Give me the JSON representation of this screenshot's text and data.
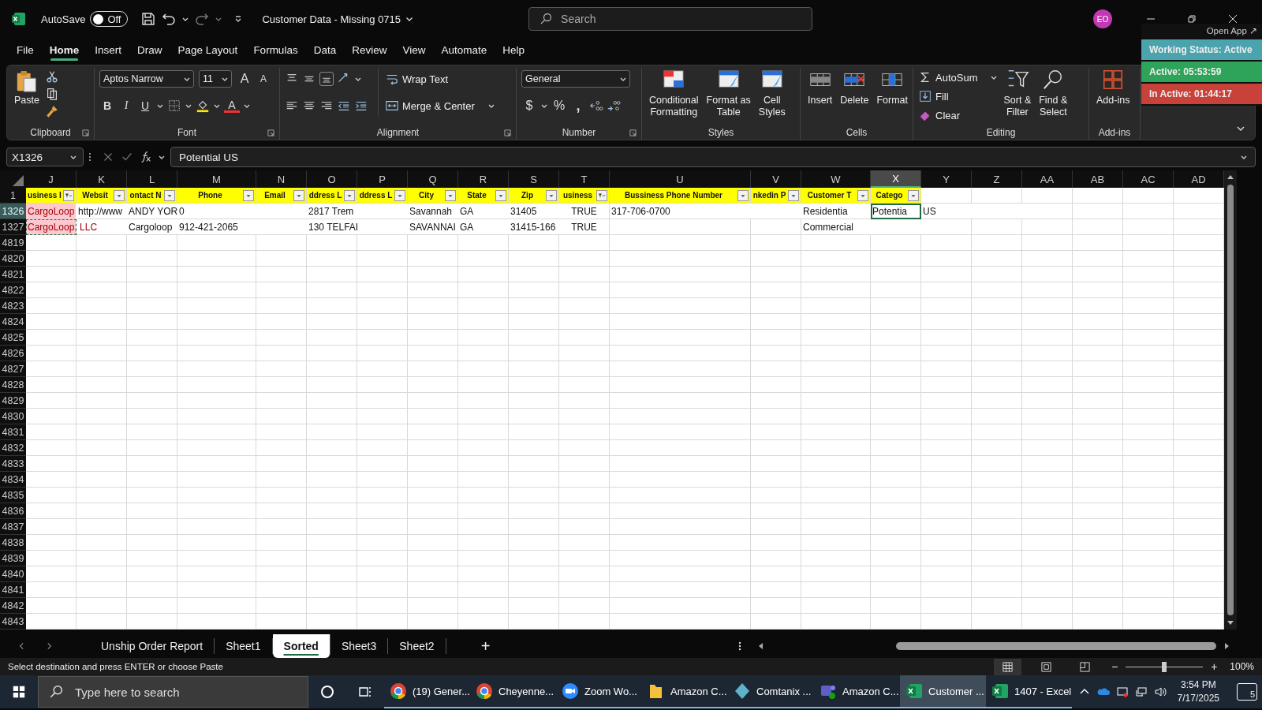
{
  "title_bar": {
    "autosave_label": "AutoSave",
    "autosave": {
      "on": false,
      "label": "Off"
    },
    "title": "Customer Data - Missing 0715",
    "search_placeholder": "Search",
    "avatar": "EO"
  },
  "menu": [
    {
      "label": "File",
      "selected": false
    },
    {
      "label": "Home",
      "selected": true
    },
    {
      "label": "Insert",
      "selected": false
    },
    {
      "label": "Draw",
      "selected": false
    },
    {
      "label": "Page Layout",
      "selected": false
    },
    {
      "label": "Formulas",
      "selected": false
    },
    {
      "label": "Data",
      "selected": false
    },
    {
      "label": "Review",
      "selected": false
    },
    {
      "label": "View",
      "selected": false
    },
    {
      "label": "Automate",
      "selected": false
    },
    {
      "label": "Help",
      "selected": false
    }
  ],
  "ribbon": {
    "clipboard": {
      "label": "Clipboard",
      "paste": "Paste"
    },
    "font": {
      "label": "Font",
      "name": "Aptos Narrow",
      "size": "11",
      "grow": "A",
      "shrink": "A",
      "bold": "B",
      "italic": "I",
      "underline": "U",
      "color_letter": "A"
    },
    "alignment": {
      "label": "Alignment",
      "wrap": "Wrap Text",
      "merge": "Merge & Center"
    },
    "number": {
      "label": "Number",
      "format": "General",
      "currency": "$",
      "percent": "%",
      "comma": ","
    },
    "styles": {
      "label": "Styles",
      "buttons": [
        "Conditional\nFormatting",
        "Format as\nTable",
        "Cell\nStyles"
      ]
    },
    "cells": {
      "label": "Cells",
      "buttons": [
        "Insert",
        "Delete",
        "Format"
      ]
    },
    "editing": {
      "label": "Editing",
      "autosum": "AutoSum",
      "fill": "Fill",
      "clear": "Clear",
      "sort": "Sort &\nFilter",
      "find": "Find &\nSelect"
    },
    "addins": {
      "label": "Add-ins",
      "button": "Add-ins"
    }
  },
  "status_widget": {
    "open_app": "Open App ↗",
    "status": "Working Status: Active",
    "active": "Active: 05:53:59",
    "inactive": "In Active: 01:44:17"
  },
  "formula_bar": {
    "name_box": "X1326",
    "formula": "Potential US"
  },
  "sheet": {
    "columns": [
      {
        "letter": "J",
        "selected": false
      },
      {
        "letter": "K",
        "selected": false
      },
      {
        "letter": "L",
        "selected": false
      },
      {
        "letter": "M",
        "selected": false
      },
      {
        "letter": "N",
        "selected": false
      },
      {
        "letter": "O",
        "selected": false
      },
      {
        "letter": "P",
        "selected": false
      },
      {
        "letter": "Q",
        "selected": false
      },
      {
        "letter": "R",
        "selected": false
      },
      {
        "letter": "S",
        "selected": false
      },
      {
        "letter": "T",
        "selected": false
      },
      {
        "letter": "U",
        "selected": false
      },
      {
        "letter": "V",
        "selected": false
      },
      {
        "letter": "W",
        "selected": false
      },
      {
        "letter": "X",
        "selected": true
      },
      {
        "letter": "Y",
        "selected": false
      },
      {
        "letter": "Z",
        "selected": false
      },
      {
        "letter": "AA",
        "selected": false
      },
      {
        "letter": "AB",
        "selected": false
      },
      {
        "letter": "AC",
        "selected": false
      },
      {
        "letter": "AD",
        "selected": false
      }
    ],
    "rows": [
      {
        "number": "1",
        "selected": false,
        "kind": "header",
        "cells": [
          {
            "text": "usiness I",
            "filtered": true
          },
          {
            "text": "Websit",
            "filtered": false
          },
          {
            "text": "ontact N",
            "filtered": false
          },
          {
            "text": "Phone",
            "filtered": false
          },
          {
            "text": "Email",
            "filtered": false
          },
          {
            "text": "ddress L",
            "filtered": false
          },
          {
            "text": "ddress L",
            "filtered": false
          },
          {
            "text": "City",
            "filtered": false
          },
          {
            "text": "State",
            "filtered": false
          },
          {
            "text": "Zip",
            "filtered": false
          },
          {
            "text": "usiness",
            "filtered": true
          },
          {
            "text": "Bussiness Phone Number",
            "filtered": false
          },
          {
            "text": "nkedin P",
            "filtered": false
          },
          {
            "text": "Customer T",
            "filtered": false
          },
          {
            "text": "Catego",
            "filtered": false
          }
        ]
      },
      {
        "number": "1326",
        "selected": true,
        "kind": "data",
        "cells": [
          {
            "text": "CargoLoop",
            "kind": "flagged",
            "copied": false
          },
          {
            "text": "http://www"
          },
          {
            "text": "ANDY YOR"
          },
          {
            "text": "0"
          },
          null,
          {
            "text": "2817 Trem"
          },
          null,
          {
            "text": "Savannah"
          },
          {
            "text": "GA"
          },
          {
            "text": "31405"
          },
          {
            "text": "TRUE",
            "centered": true
          },
          {
            "text": "317-706-0700"
          },
          null,
          {
            "text": "Residentia"
          },
          {
            "text": "Potentia",
            "active": true
          },
          {
            "text": "US"
          }
        ]
      },
      {
        "number": "1327",
        "selected": false,
        "kind": "data",
        "cells": [
          {
            "text": "CargoLoop, LLC",
            "kind": "flagged",
            "copied": true
          },
          null,
          {
            "text": "Cargoloop"
          },
          {
            "text": "912-421-2065"
          },
          null,
          {
            "text": "130 TELFAI"
          },
          null,
          {
            "text": "SAVANNAI"
          },
          {
            "text": "GA"
          },
          {
            "text": "31415-166"
          },
          {
            "text": "TRUE",
            "centered": true
          },
          null,
          null,
          {
            "text": "Commercial"
          }
        ]
      },
      {
        "number": "4819",
        "selected": false,
        "kind": "data"
      },
      {
        "number": "4820",
        "selected": false,
        "kind": "data"
      },
      {
        "number": "4821",
        "selected": false,
        "kind": "data"
      },
      {
        "number": "4822",
        "selected": false,
        "kind": "data"
      },
      {
        "number": "4823",
        "selected": false,
        "kind": "data"
      },
      {
        "number": "4824",
        "selected": false,
        "kind": "data"
      },
      {
        "number": "4825",
        "selected": false,
        "kind": "data"
      },
      {
        "number": "4826",
        "selected": false,
        "kind": "data"
      },
      {
        "number": "4827",
        "selected": false,
        "kind": "data"
      },
      {
        "number": "4828",
        "selected": false,
        "kind": "data"
      },
      {
        "number": "4829",
        "selected": false,
        "kind": "data"
      },
      {
        "number": "4830",
        "selected": false,
        "kind": "data"
      },
      {
        "number": "4831",
        "selected": false,
        "kind": "data"
      },
      {
        "number": "4832",
        "selected": false,
        "kind": "data"
      },
      {
        "number": "4833",
        "selected": false,
        "kind": "data"
      },
      {
        "number": "4834",
        "selected": false,
        "kind": "data"
      },
      {
        "number": "4835",
        "selected": false,
        "kind": "data"
      },
      {
        "number": "4836",
        "selected": false,
        "kind": "data"
      },
      {
        "number": "4837",
        "selected": false,
        "kind": "data"
      },
      {
        "number": "4838",
        "selected": false,
        "kind": "data"
      },
      {
        "number": "4839",
        "selected": false,
        "kind": "data"
      },
      {
        "number": "4840",
        "selected": false,
        "kind": "data"
      },
      {
        "number": "4841",
        "selected": false,
        "kind": "data"
      },
      {
        "number": "4842",
        "selected": false,
        "kind": "data"
      },
      {
        "number": "4843",
        "selected": false,
        "kind": "data"
      }
    ]
  },
  "sheet_tabs": [
    {
      "label": "Unship Order Report",
      "selected": false
    },
    {
      "label": "Sheet1",
      "selected": false
    },
    {
      "label": "Sorted",
      "selected": true
    },
    {
      "label": "Sheet3",
      "selected": false
    },
    {
      "label": "Sheet2",
      "selected": false
    }
  ],
  "add_sheet": "+",
  "status_bar": {
    "message": "Select destination and press ENTER or choose Paste",
    "zoom_out": "−",
    "zoom_in": "+",
    "level": 0.5,
    "zoom": "100%"
  },
  "taskbar": {
    "search_placeholder": "Type here to search",
    "apps": [
      {
        "label": "(19) Gener...",
        "kind": "chrome",
        "selected": false
      },
      {
        "label": "Cheyenne...",
        "kind": "chrome",
        "selected": false
      },
      {
        "label": "Zoom Wo...",
        "kind": "zoom",
        "selected": false
      },
      {
        "label": "Amazon C...",
        "kind": "folder",
        "selected": false
      },
      {
        "label": "Comtanix ...",
        "kind": "diamond",
        "selected": false
      },
      {
        "label": "Amazon C...",
        "kind": "teams",
        "selected": false
      },
      {
        "label": "Customer ...",
        "kind": "excel",
        "selected": true
      },
      {
        "label": "1407 - Excel",
        "kind": "excel",
        "selected": false
      }
    ],
    "time": "3:54 PM",
    "date": "7/17/2025",
    "notifications": "5"
  }
}
